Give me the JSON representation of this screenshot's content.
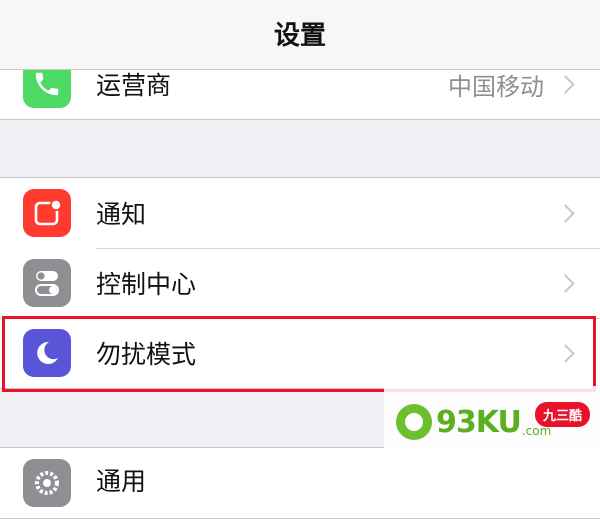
{
  "nav": {
    "title": "设置"
  },
  "rows": {
    "carrier": {
      "label": "运营商",
      "detail": "中国移动",
      "icon": "phone-icon",
      "color": "#4cd964"
    },
    "notifications": {
      "label": "通知",
      "icon": "notification-icon",
      "color": "#ff3b30"
    },
    "control_center": {
      "label": "控制中心",
      "icon": "toggles-icon",
      "color": "#8e8e93"
    },
    "do_not_disturb": {
      "label": "勿扰模式",
      "icon": "moon-icon",
      "color": "#5856d6"
    },
    "general": {
      "label": "通用",
      "icon": "gear-icon",
      "color": "#8e8e93"
    }
  },
  "highlight_color": "#e8132a",
  "watermark": {
    "text": "93KU",
    "suffix": ".com",
    "badge": "九三酷"
  }
}
